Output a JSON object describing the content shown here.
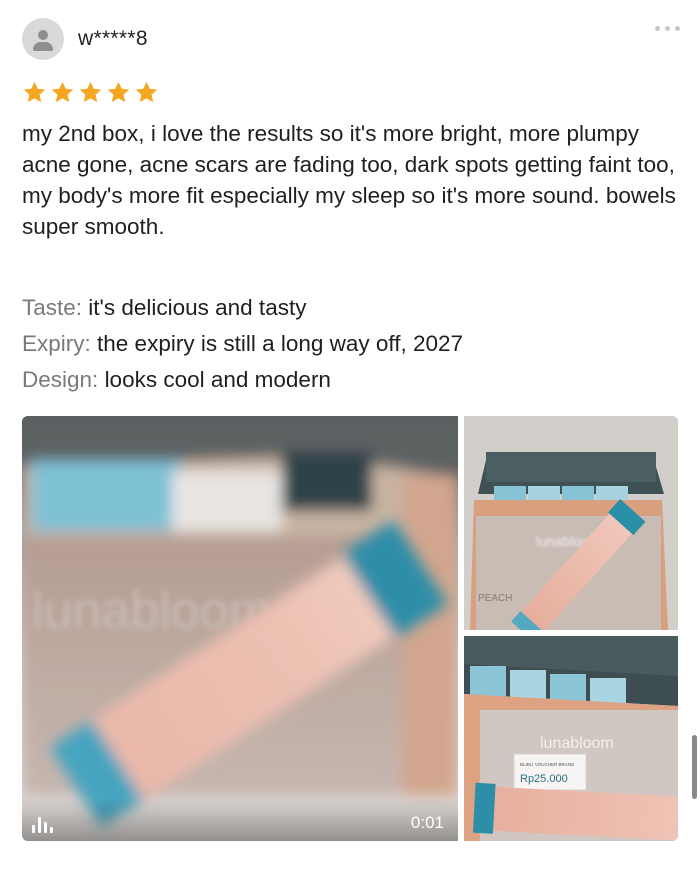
{
  "reviewer": {
    "name": "w*****8",
    "avatar_icon": "person-icon"
  },
  "menu_icon": "more-dots-icon",
  "rating": {
    "stars": 5,
    "max": 5,
    "color": "#f5a623"
  },
  "review": {
    "lines": [
      "my 2nd box, i love the results so it's more bright, more plumpy",
      "acne gone, acne scars are fading too, dark spots getting faint too, my body's more fit especially my sleep so it's more sound. bowels super smooth."
    ]
  },
  "attributes": [
    {
      "key": "Taste:",
      "value": "it's delicious and tasty"
    },
    {
      "key": "Expiry:",
      "value": "the expiry is still a long way off, 2027"
    },
    {
      "key": "Design:",
      "value": "looks cool and modern"
    }
  ],
  "media": {
    "video": {
      "duration": "0:01",
      "brand_text": "lunabloom",
      "icon": "audio-bars-icon"
    },
    "thumb1": {
      "brand_text": "lunabloom",
      "flavor": "PEACH"
    },
    "thumb2": {
      "brand_text": "lunabloom",
      "voucher_caption": "BLIBLI VOUCHER BRAND",
      "voucher_value": "Rp25.000"
    }
  }
}
